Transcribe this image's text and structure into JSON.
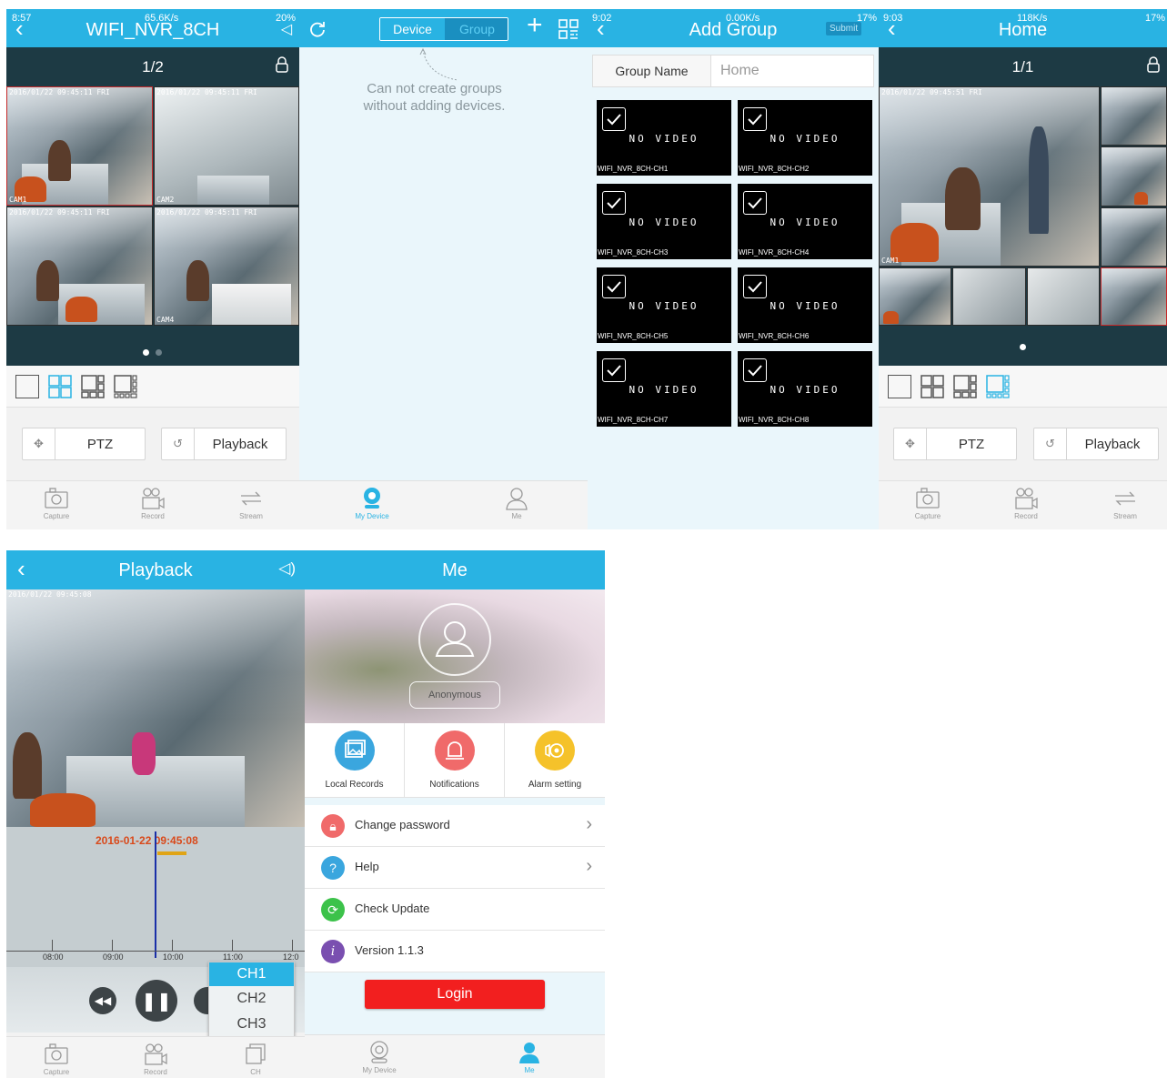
{
  "panel1": {
    "status_time": "8:57",
    "status_net": "65.6K/s",
    "status_battery": "20%",
    "title": "WIFI_NVR_8CH",
    "page_indicator": "1/2",
    "ptz_label": "PTZ",
    "playback_label": "Playback",
    "tabs": [
      "Capture",
      "Record",
      "Stream"
    ],
    "timestamps": [
      "2016/01/22 09:45:11 FRI",
      "2016/01/22 09:45:11 FRI",
      "2016/01/22 09:45:11 FRI",
      "2016/01/22 09:45:11 FRI"
    ],
    "cam_labels": [
      "CAM1",
      "CAM2",
      "",
      "CAM4"
    ]
  },
  "panel2": {
    "seg_device": "Device",
    "seg_group": "Group",
    "empty_text_line1": "Can not create groups",
    "empty_text_line2": "without adding devices.",
    "tabs": [
      "My Device",
      "Me"
    ]
  },
  "panel3": {
    "status_time": "9:02",
    "status_net": "0.00K/s",
    "status_battery": "17%",
    "title": "Add Group",
    "submit_label": "Submit",
    "group_name_label": "Group Name",
    "group_name_value": "Home",
    "no_video": "NO VIDEO",
    "channels": [
      "WIFI_NVR_8CH-CH1",
      "WIFI_NVR_8CH-CH2",
      "WIFI_NVR_8CH-CH3",
      "WIFI_NVR_8CH-CH4",
      "WIFI_NVR_8CH-CH5",
      "WIFI_NVR_8CH-CH6",
      "WIFI_NVR_8CH-CH7",
      "WIFI_NVR_8CH-CH8"
    ]
  },
  "panel4": {
    "status_time": "9:03",
    "status_net": "118K/s",
    "status_battery": "17%",
    "title": "Home",
    "page_indicator": "1/1",
    "ptz_label": "PTZ",
    "playback_label": "Playback",
    "tabs": [
      "Capture",
      "Record",
      "Stream"
    ],
    "timestamp": "2016/01/22 09:45:51 FRI",
    "cam_label": "CAM1"
  },
  "panel5": {
    "title": "Playback",
    "timestamp": "2016/01/22 09:45:08",
    "timeline_time": "2016-01-22 09:45:08",
    "ticks": [
      "08:00",
      "09:00",
      "10:00",
      "11:00",
      "12:0"
    ],
    "channels": [
      "CH1",
      "CH2",
      "CH3"
    ],
    "tabs": [
      "Capture",
      "Record",
      "CH"
    ]
  },
  "panel6": {
    "title": "Me",
    "user": "Anonymous",
    "features": [
      "Local Records",
      "Notifications",
      "Alarm setting"
    ],
    "menu": [
      {
        "label": "Change password",
        "chevron": true
      },
      {
        "label": "Help",
        "chevron": true
      },
      {
        "label": "Check Update",
        "chevron": false
      },
      {
        "label": "Version 1.1.3",
        "chevron": false
      }
    ],
    "login_label": "Login",
    "tabs": [
      "My Device",
      "Me"
    ]
  },
  "colors": {
    "accent": "#29b3e3",
    "dark_teal": "#1d3a44",
    "login_red": "#f21f1f",
    "timeline_date": "#d9491a"
  }
}
